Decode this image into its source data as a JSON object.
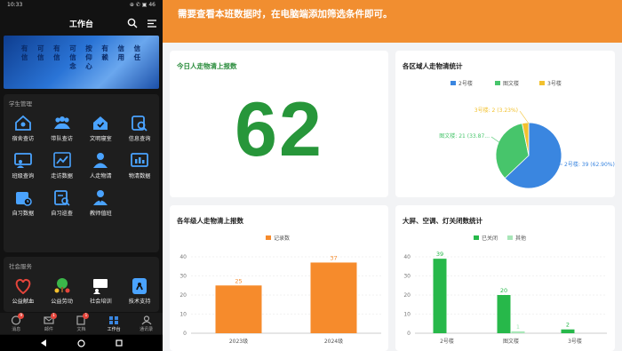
{
  "phone": {
    "status_time": "10:33",
    "status_icons": "⊕ ✆ ▣ 46",
    "app_title": "工作台",
    "banner_text": "有 可 有 可 按 有 信 信 信 信 信 信 仰 赖 用 任 念 心",
    "sections": [
      {
        "title": "学生管理",
        "items": [
          {
            "label": "宿舍查访",
            "icon": "house-people-icon",
            "color": "#4aa3ff"
          },
          {
            "label": "带队查访",
            "icon": "group-icon",
            "color": "#4aa3ff"
          },
          {
            "label": "文明寝室",
            "icon": "home-check-icon",
            "color": "#4aa3ff"
          },
          {
            "label": "信息查询",
            "icon": "search-doc-icon",
            "color": "#4aa3ff"
          },
          {
            "label": "班级查询",
            "icon": "class-icon",
            "color": "#4aa3ff"
          },
          {
            "label": "走访数据",
            "icon": "trend-icon",
            "color": "#4aa3ff"
          },
          {
            "label": "人走物清",
            "icon": "person-icon",
            "color": "#4aa3ff"
          },
          {
            "label": "物清数据",
            "icon": "data-icon",
            "color": "#4aa3ff"
          },
          {
            "label": "自习数据",
            "icon": "calendar-icon",
            "color": "#4aa3ff"
          },
          {
            "label": "自习巡查",
            "icon": "inspect-icon",
            "color": "#4aa3ff"
          },
          {
            "label": "教师值班",
            "icon": "teacher-icon",
            "color": "#4aa3ff"
          }
        ]
      },
      {
        "title": "社会服务",
        "items": [
          {
            "label": "公益献血",
            "icon": "heart-icon",
            "color": "#e5453b"
          },
          {
            "label": "公益劳动",
            "icon": "tree-icon",
            "color": "#f4c02d"
          },
          {
            "label": "社会培训",
            "icon": "training-icon",
            "color": "#ffffff"
          },
          {
            "label": "技术支持",
            "icon": "support-icon",
            "color": "#4aa3ff"
          }
        ]
      }
    ],
    "tabs": [
      {
        "label": "消息",
        "badge": "9"
      },
      {
        "label": "邮件",
        "badge": "1"
      },
      {
        "label": "文档",
        "badge": "1"
      },
      {
        "label": "工作台",
        "badge": ""
      },
      {
        "label": "通讯录",
        "badge": ""
      }
    ]
  },
  "dashboard": {
    "notice": "需要查看本班数据时，在电脑端添加筛选条件即可。",
    "today_card": {
      "title": "今日人走物清上报数",
      "value": "62"
    },
    "pie_card": {
      "title": "各区域人走物清统计"
    },
    "bar1_card": {
      "title": "各年级人走物清上报数"
    },
    "bar2_card": {
      "title": "大屏、空调、灯关闭数统计"
    }
  },
  "chart_data": [
    {
      "type": "pie",
      "title": "各区域人走物清统计",
      "legend": "top",
      "slices": [
        {
          "name": "2号楼",
          "value": 39,
          "label": "2号楼: 39 (62.90%)",
          "color": "#3a86e0"
        },
        {
          "name": "图文楼",
          "value": 21,
          "label": "图文楼: 21 (33.87...",
          "color": "#47c56b"
        },
        {
          "name": "3号楼",
          "value": 2,
          "label": "3号楼: 2 (3.23%)",
          "color": "#f2c12e"
        }
      ]
    },
    {
      "type": "bar",
      "title": "各年级人走物清上报数",
      "categories": [
        "2023级",
        "2024级"
      ],
      "series": [
        {
          "name": "记录数",
          "values": [
            25,
            37
          ],
          "color": "#f68b2c"
        }
      ],
      "ylim": [
        0,
        40
      ],
      "yticks": [
        0,
        10,
        20,
        30,
        40
      ],
      "grid": true,
      "legend": "top"
    },
    {
      "type": "bar",
      "title": "大屏、空调、灯关闭数统计",
      "categories": [
        "2号楼",
        "图文楼",
        "3号楼"
      ],
      "series": [
        {
          "name": "已关闭",
          "values": [
            39,
            20,
            2
          ],
          "color": "#27b84a"
        },
        {
          "name": "其他",
          "values": [
            0,
            1,
            0
          ],
          "color": "#a8e6b8"
        }
      ],
      "ylim": [
        0,
        40
      ],
      "yticks": [
        0,
        10,
        20,
        30,
        40
      ],
      "grid": true,
      "legend": "top"
    }
  ]
}
